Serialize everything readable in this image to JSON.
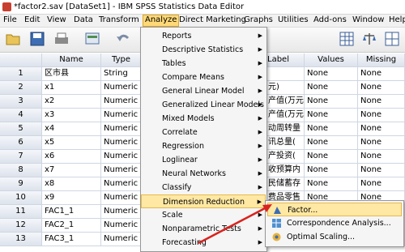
{
  "window": {
    "title": "*factor2.sav [DataSet1] - IBM SPSS Statistics Data Editor"
  },
  "menubar": {
    "items": [
      "File",
      "Edit",
      "View",
      "Data",
      "Transform",
      "Analyze",
      "Direct Marketing",
      "Graphs",
      "Utilities",
      "Add-ons",
      "Window",
      "Help"
    ]
  },
  "grid": {
    "columns": [
      "Name",
      "Type",
      "Label",
      "Values",
      "Missing"
    ],
    "rows": [
      {
        "num": "1",
        "name": "区市县",
        "type": "String",
        "label": "",
        "values": "None",
        "missing": "None"
      },
      {
        "num": "2",
        "name": "x1",
        "type": "Numeric",
        "label": "元)",
        "values": "None",
        "missing": "None"
      },
      {
        "num": "3",
        "name": "x2",
        "type": "Numeric",
        "label": "产值(万元)",
        "values": "None",
        "missing": "None"
      },
      {
        "num": "4",
        "name": "x3",
        "type": "Numeric",
        "label": "产值(万元)",
        "values": "None",
        "missing": "None"
      },
      {
        "num": "5",
        "name": "x4",
        "type": "Numeric",
        "label": "动周转量",
        "values": "None",
        "missing": "None"
      },
      {
        "num": "6",
        "name": "x5",
        "type": "Numeric",
        "label": "讯总量(",
        "values": "None",
        "missing": "None"
      },
      {
        "num": "7",
        "name": "x6",
        "type": "Numeric",
        "label": "产投资(",
        "values": "None",
        "missing": "None"
      },
      {
        "num": "8",
        "name": "x7",
        "type": "Numeric",
        "label": "收预算内",
        "values": "None",
        "missing": "None"
      },
      {
        "num": "9",
        "name": "x8",
        "type": "Numeric",
        "label": "民储蓄存",
        "values": "None",
        "missing": "None"
      },
      {
        "num": "10",
        "name": "x9",
        "type": "Numeric",
        "label": "费品零售",
        "values": "None",
        "missing": "None"
      },
      {
        "num": "11",
        "name": "FAC1_1",
        "type": "Numeric",
        "label": "",
        "values": "None",
        "missing": "None"
      },
      {
        "num": "12",
        "name": "FAC2_1",
        "type": "Numeric",
        "label": "",
        "values": "None",
        "missing": "None"
      },
      {
        "num": "13",
        "name": "FAC3_1",
        "type": "Numeric",
        "label": "",
        "values": "None",
        "missing": "None"
      }
    ]
  },
  "analyze_menu": {
    "items": [
      {
        "label": "Reports",
        "arrow": true
      },
      {
        "label": "Descriptive Statistics",
        "arrow": true
      },
      {
        "label": "Tables",
        "arrow": true
      },
      {
        "label": "Compare Means",
        "arrow": true
      },
      {
        "label": "General Linear Model",
        "arrow": true
      },
      {
        "label": "Generalized Linear Models",
        "arrow": true
      },
      {
        "label": "Mixed Models",
        "arrow": true
      },
      {
        "label": "Correlate",
        "arrow": true
      },
      {
        "label": "Regression",
        "arrow": true
      },
      {
        "label": "Loglinear",
        "arrow": true
      },
      {
        "label": "Neural Networks",
        "arrow": true
      },
      {
        "label": "Classify",
        "arrow": true
      },
      {
        "label": "Dimension Reduction",
        "arrow": true,
        "highlighted": true
      },
      {
        "label": "Scale",
        "arrow": true
      },
      {
        "label": "Nonparametric Tests",
        "arrow": true
      },
      {
        "label": "Forecasting",
        "arrow": true
      }
    ]
  },
  "dimension_submenu": {
    "items": [
      {
        "label": "Factor...",
        "icon": "factor-icon",
        "highlighted": true
      },
      {
        "label": "Correspondence Analysis...",
        "icon": "correspondence-icon"
      },
      {
        "label": "Optimal Scaling...",
        "icon": "optimal-scaling-icon"
      }
    ]
  },
  "colors": {
    "highlight": "#ffe8a3",
    "arrow": "#d9231f",
    "header": "#dde3ec"
  }
}
